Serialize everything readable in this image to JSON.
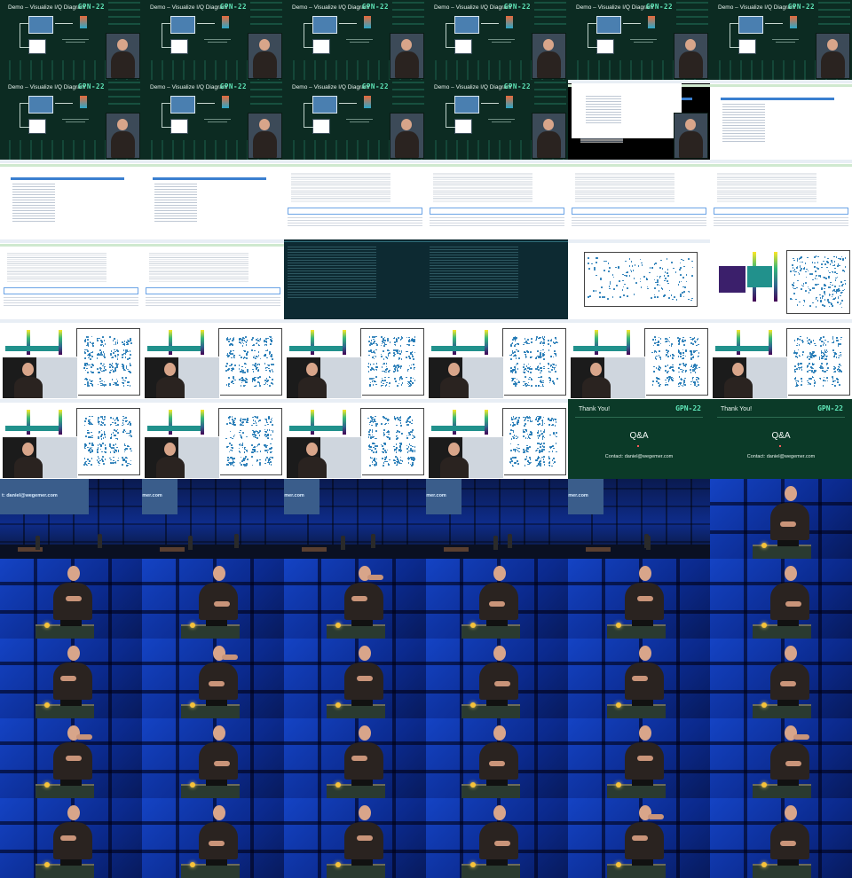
{
  "demo_slide": {
    "title": "Demo – Visualize I/Q Diagram",
    "logo": "GPN-22"
  },
  "thanks_slide": {
    "title": "Thank You!",
    "logo": "GPN-22",
    "heading": "Q&A",
    "contact": "Contact: daniel@wegemer.com"
  },
  "stage_screen": {
    "text": "t: daniel@wegemer.com"
  },
  "tiles": [
    "demo",
    "demo",
    "demo",
    "demo",
    "demo",
    "demo",
    "demo",
    "demo",
    "demo",
    "demo",
    "nb-dark",
    "nb-list",
    "nb-list",
    "nb-list",
    "nb-table",
    "nb-table",
    "nb-table",
    "nb-table",
    "nb-table2",
    "nb-table2",
    "term",
    "term",
    "plot-scatter",
    "plot-hist",
    "plot-video",
    "plot-video",
    "plot-video",
    "plot-video",
    "plot-video",
    "plot-video",
    "plot-video",
    "plot-video",
    "plot-video",
    "plot-video",
    "thanks",
    "thanks",
    "stage",
    "stage",
    "stage",
    "stage",
    "stage",
    "speaker",
    "speaker",
    "speaker",
    "speaker",
    "speaker",
    "speaker",
    "speaker",
    "speaker",
    "speaker",
    "speaker",
    "speaker",
    "speaker",
    "speaker",
    "speaker",
    "speaker",
    "speaker",
    "speaker",
    "speaker",
    "speaker",
    "speaker",
    "speaker",
    "speaker",
    "speaker",
    "speaker",
    "speaker"
  ]
}
